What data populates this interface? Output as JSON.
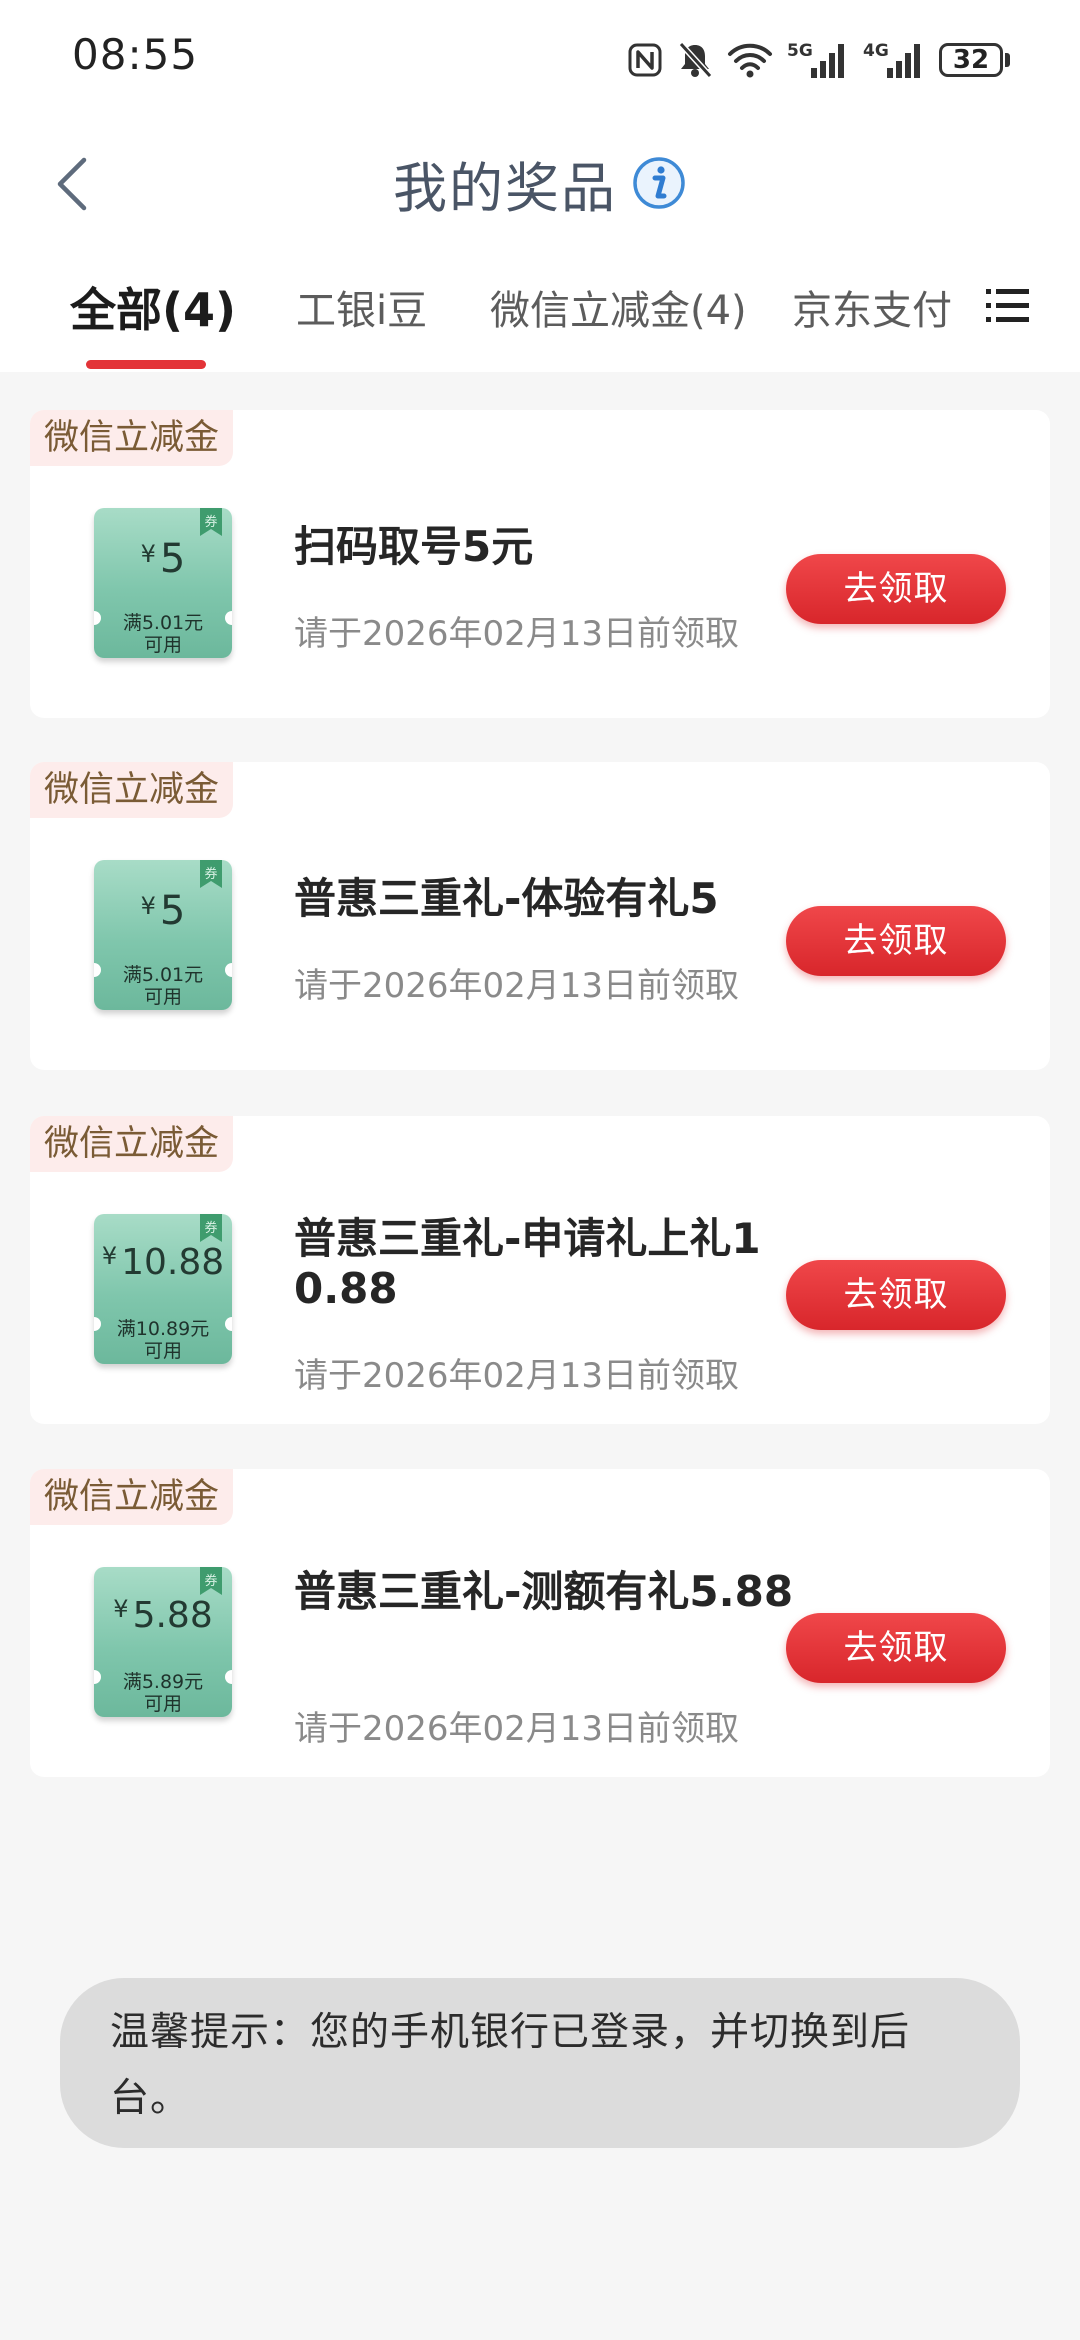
{
  "status_bar": {
    "time": "08:55",
    "battery": "32",
    "network_5g": "5G",
    "network_4g": "4G",
    "icons": [
      "nfc-icon",
      "mute-bell-icon",
      "wifi-icon",
      "signal-5g-icon",
      "signal-4g-icon",
      "battery-icon"
    ]
  },
  "header": {
    "title": "我的奖品",
    "back_icon": "chevron-left-icon",
    "info_icon": "info-icon"
  },
  "tabs": [
    {
      "label": "全部(4)",
      "active": true
    },
    {
      "label": "工银i豆",
      "active": false
    },
    {
      "label": "微信立减金(4)",
      "active": false
    },
    {
      "label": "京东支付",
      "active": false
    }
  ],
  "tab_menu_icon": "list-menu-icon",
  "prizes": [
    {
      "tag": "微信立减金",
      "currency": "¥",
      "amount": "5",
      "cond_line1": "满5.01元",
      "cond_line2": "可用",
      "ribbon": "券",
      "title": "扫码取号5元",
      "deadline": "请于2026年02月13日前领取",
      "button": "去领取"
    },
    {
      "tag": "微信立减金",
      "currency": "¥",
      "amount": "5",
      "cond_line1": "满5.01元",
      "cond_line2": "可用",
      "ribbon": "券",
      "title": "普惠三重礼-体验有礼5",
      "deadline": "请于2026年02月13日前领取",
      "button": "去领取"
    },
    {
      "tag": "微信立减金",
      "currency": "¥",
      "amount": "10.88",
      "cond_line1": "满10.89元",
      "cond_line2": "可用",
      "ribbon": "券",
      "title": "普惠三重礼-申请礼上礼10.88",
      "deadline": "请于2026年02月13日前领取",
      "button": "去领取"
    },
    {
      "tag": "微信立减金",
      "currency": "¥",
      "amount": "5.88",
      "cond_line1": "满5.89元",
      "cond_line2": "可用",
      "ribbon": "券",
      "title": "普惠三重礼-测额有礼5.88",
      "deadline": "请于2026年02月13日前领取",
      "button": "去领取"
    }
  ],
  "toast": {
    "text": "温馨提示：您的手机银行已登录，并切换到后台。"
  }
}
